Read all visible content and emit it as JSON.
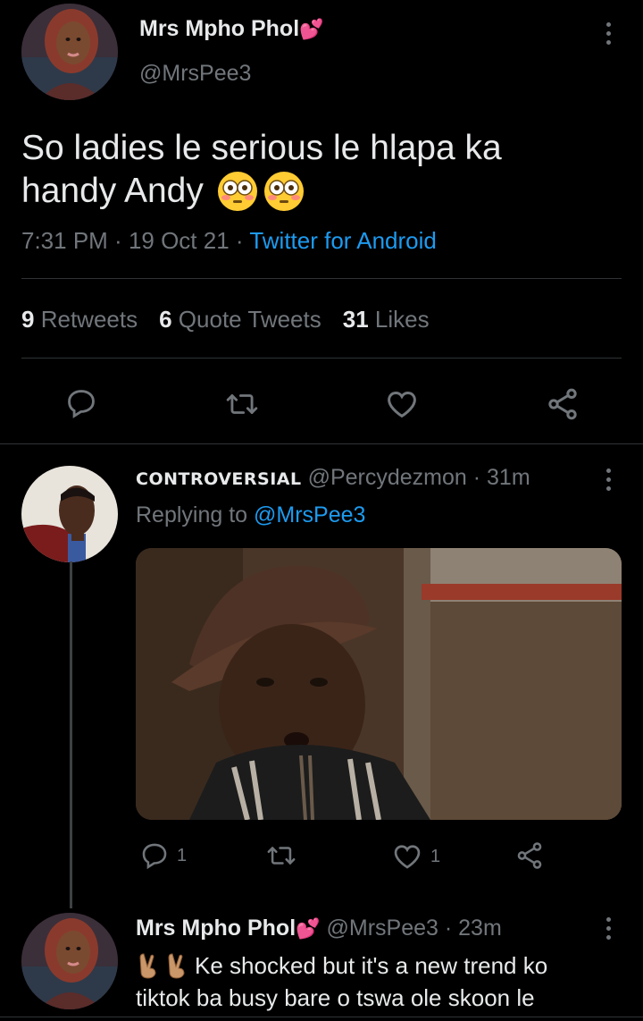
{
  "main_tweet": {
    "display_name": "Mrs Mpho Phol",
    "name_emoji": "💕",
    "handle": "@MrsPee3",
    "text_line1": "So ladies le serious le hlapa ka",
    "text_line2": "handy Andy",
    "time": "7:31 PM",
    "date": "19 Oct 21",
    "source": "Twitter for Android",
    "retweets_count": "9",
    "retweets_label": "Retweets",
    "quotes_count": "6",
    "quotes_label": "Quote Tweets",
    "likes_count": "31",
    "likes_label": "Likes"
  },
  "reply1": {
    "display_name": "CONTROVERSIAL",
    "handle": "@Percydezmon",
    "age": "31m",
    "replying_prefix": "Replying to",
    "replying_handle": "@MrsPee3",
    "reply_count": "1",
    "like_count": "1"
  },
  "reply2": {
    "display_name": "Mrs Mpho Phol",
    "name_emoji": "💕",
    "handle": "@MrsPee3",
    "age": "23m",
    "text_line1": "Ke shocked but it's a new trend ko",
    "text_line2": "tiktok ba busy bare o tswa ole skoon le"
  },
  "icons": [
    "reply-icon",
    "retweet-icon",
    "like-icon",
    "share-icon",
    "more-icon",
    "flushed-emoji-icon",
    "fingers-crossed-emoji-icon"
  ],
  "colors": {
    "background": "#000000",
    "text": "#e7e9ea",
    "muted": "#71767b",
    "link": "#1d9bf0",
    "divider": "#2f3336"
  }
}
